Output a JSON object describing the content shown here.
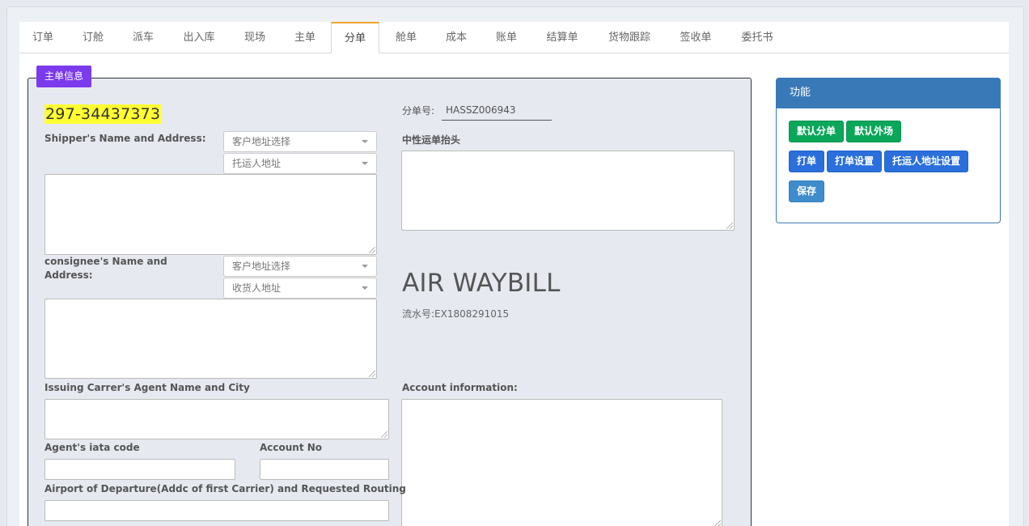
{
  "tabs": [
    "订单",
    "订舱",
    "派车",
    "出入库",
    "现场",
    "主单",
    "分单",
    "舱单",
    "成本",
    "账单",
    "结算单",
    "货物跟踪",
    "签收单",
    "委托书"
  ],
  "active_tab": "分单",
  "legend": "主单信息",
  "mawb_no": "297-34437373",
  "sub_no_label": "分单号:",
  "sub_no_value": "HASSZ006943",
  "labels": {
    "shipper": "Shipper's Name and Address:",
    "neutral_header": "中性运单抬头",
    "consignee_line1": "consignee's Name and",
    "consignee_line2": "Address:",
    "issuing_agent": "Issuing Carrer's Agent Name and City",
    "account_info": "Account information:",
    "agent_iata": "Agent's iata code",
    "account_no": "Account No",
    "airport_departure": "Airport of Departure(Addc of first Carrier) and Requested Routing"
  },
  "selects": {
    "shipper_customer": "客户地址选择",
    "shipper_address": "托运人地址",
    "consignee_customer": "客户地址选择",
    "consignee_address": "收货人地址"
  },
  "title": "AIR WAYBILL",
  "serial": "流水号:EX1808291015",
  "panel": {
    "title": "功能",
    "buttons": {
      "default_sub": "默认分单",
      "default_outside": "默认外场",
      "print": "打单",
      "print_settings": "打单设置",
      "shipper_address_settings": "托运人地址设置",
      "save": "保存"
    }
  }
}
